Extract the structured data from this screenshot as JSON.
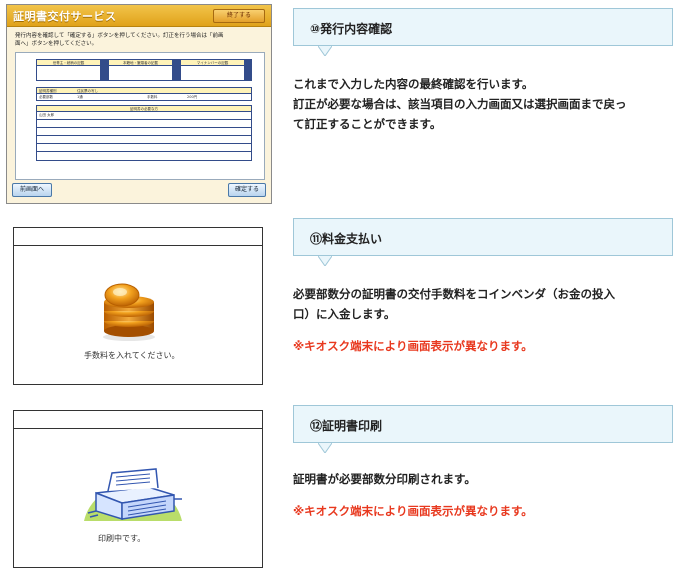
{
  "screen1": {
    "title": "証明書交付サービス",
    "end_button": "終了する",
    "instruction_line1": "発行内容を確認して「確定する」ボタンを押してください。訂正を行う場合は「前画",
    "instruction_line2": "面へ」ボタンを押してください。",
    "header_cells": [
      "世帯主・続柄の記載",
      "本籍地・筆頭者の記載",
      "マイナンバーの記載"
    ],
    "row1_label": "証明書種別",
    "row1_value": "住民票の写し",
    "row2_label": "必要部数",
    "row2_value": "1通",
    "row2_fee_label": "手数料",
    "row2_fee_value": "200円",
    "list_header": "証明書の必要な方",
    "list_first": "山田 太郎",
    "back_button": "前画面へ",
    "confirm_button": "確定する"
  },
  "screen2": {
    "caption": "手数料を入れてください。"
  },
  "screen3": {
    "caption": "印刷中です。"
  },
  "steps": [
    {
      "label": "⑩発行内容確認",
      "desc_line1": "これまで入力した内容の最終確認を行います。",
      "desc_line2": "訂正が必要な場合は、該当項目の入力画面又は選択画面まで戻っ",
      "desc_line3": "て訂正することができます。"
    },
    {
      "label": "⑪料金支払い",
      "desc_line1": "必要部数分の証明書の交付手数料をコインベンダ（お金の投入",
      "desc_line2": "口）に入金します。",
      "warning": "※キオスク端末により画面表示が異なります。"
    },
    {
      "label": "⑫証明書印刷",
      "desc_line1": "証明書が必要部数分印刷されます。",
      "warning": "※キオスク端末により画面表示が異なります。"
    }
  ],
  "colors": {
    "accent_warning": "#e8381e",
    "step_bg": "#eaf6fb",
    "step_border": "#9fc7d8"
  }
}
